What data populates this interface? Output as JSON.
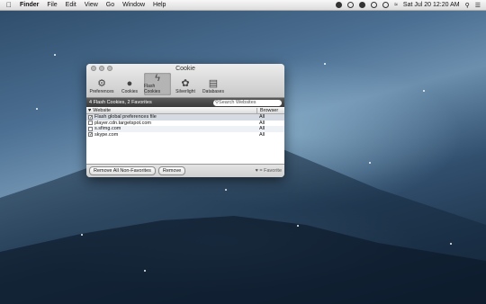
{
  "menubar": {
    "app": "Finder",
    "items": [
      "File",
      "Edit",
      "View",
      "Go",
      "Window",
      "Help"
    ],
    "clock": "Sat Jul 20  12:20 AM"
  },
  "window": {
    "title": "Cookie",
    "toolbar": [
      {
        "label": "Preferences",
        "icon": "gear-icon"
      },
      {
        "label": "Cookies",
        "icon": "cookie-icon"
      },
      {
        "label": "Flash Cookies",
        "icon": "flash-icon"
      },
      {
        "label": "Silverlight",
        "icon": "silverlight-icon"
      },
      {
        "label": "Databases",
        "icon": "database-icon"
      }
    ],
    "active_tab": "Flash Cookies",
    "summary": "4 Flash Cookies, 2 Favorites",
    "search_placeholder": "Search Websites",
    "columns": {
      "website": "Website",
      "browser": "Browser"
    },
    "rows": [
      {
        "website": "Flash global preferences file",
        "browser": "All",
        "favorite": true
      },
      {
        "website": "player.cdn.targetspot.com",
        "browser": "All",
        "favorite": false
      },
      {
        "website": "s.sfimg.com",
        "browser": "All",
        "favorite": false
      },
      {
        "website": "skype.com",
        "browser": "All",
        "favorite": true
      }
    ],
    "buttons": {
      "remove_all": "Remove All Non-Favorites",
      "remove": "Remove"
    },
    "legend": "= Favorite"
  }
}
